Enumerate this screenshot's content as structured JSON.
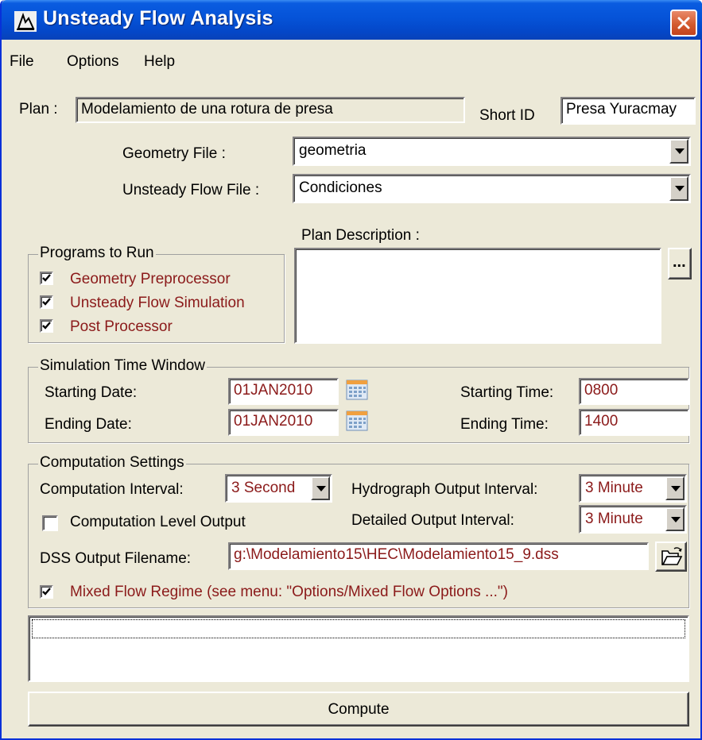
{
  "window": {
    "title": "Unsteady Flow Analysis"
  },
  "menu": [
    "File",
    "Options",
    "Help"
  ],
  "plan": {
    "label": "Plan :",
    "value": "Modelamiento de una rotura de presa",
    "short_id_label": "Short ID",
    "short_id": "Presa Yuracmay"
  },
  "geometry_file": {
    "label": "Geometry File :",
    "value": "geometria"
  },
  "unsteady_flow_file": {
    "label": "Unsteady Flow File :",
    "value": "Condiciones"
  },
  "plan_description": {
    "label": "Plan Description :",
    "value": "",
    "browse_label": "..."
  },
  "programs": {
    "title": "Programs to Run",
    "items": [
      {
        "label": "Geometry Preprocessor",
        "checked": true
      },
      {
        "label": "Unsteady Flow Simulation",
        "checked": true
      },
      {
        "label": "Post Processor",
        "checked": true
      }
    ]
  },
  "time_window": {
    "title": "Simulation Time Window",
    "starting_date_label": "Starting Date:",
    "starting_date": "01JAN2010",
    "ending_date_label": "Ending Date:",
    "ending_date": "01JAN2010",
    "starting_time_label": "Starting Time:",
    "starting_time": "0800",
    "ending_time_label": "Ending Time:",
    "ending_time": "1400"
  },
  "computation": {
    "title": "Computation Settings",
    "interval_label": "Computation Interval:",
    "interval": "3 Second",
    "hydrograph_label": "Hydrograph Output Interval:",
    "hydrograph": "3 Minute",
    "level_output_label": "Computation Level Output",
    "level_output_checked": false,
    "detailed_label": "Detailed Output Interval:",
    "detailed": "3 Minute",
    "dss_label": "DSS Output Filename:",
    "dss": "g:\\Modelamiento15\\HEC\\Modelamiento15_9.dss",
    "mixed_flow_label": "Mixed Flow Regime (see menu: \"Options/Mixed Flow Options ...\")",
    "mixed_flow_checked": true
  },
  "compute_label": "Compute",
  "colors": {
    "titlebar": "#0553d8",
    "face": "#ece9d8",
    "option_text": "#8b1a1a",
    "close": "#d45b2f"
  }
}
